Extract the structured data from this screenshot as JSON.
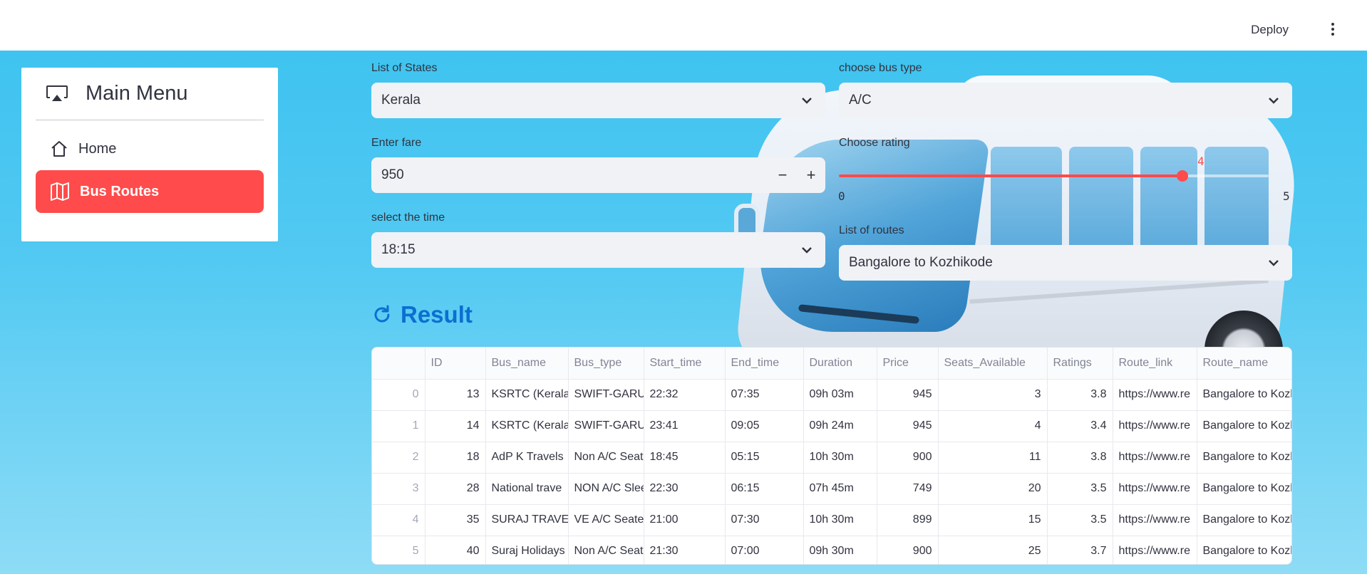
{
  "header": {
    "deploy_label": "Deploy",
    "menu_icon": "kebab-menu-icon"
  },
  "sidebar": {
    "title": "Main Menu",
    "title_icon": "airplay-icon",
    "items": [
      {
        "label": "Home",
        "icon": "home-icon",
        "active": false
      },
      {
        "label": "Bus Routes",
        "icon": "map-icon",
        "active": true
      }
    ]
  },
  "filters": {
    "states": {
      "label": "List of States",
      "value": "Kerala"
    },
    "bus_type": {
      "label": "choose bus type",
      "value": "A/C"
    },
    "fare": {
      "label": "Enter fare",
      "value": "950",
      "minus": "−",
      "plus": "+"
    },
    "rating": {
      "label": "Choose rating",
      "value": "4",
      "min": "0",
      "max": "5",
      "fraction": 0.8
    },
    "time": {
      "label": "select the time",
      "value": "18:15"
    },
    "routes": {
      "label": "List of routes",
      "value": "Bangalore to Kozhikode"
    }
  },
  "result": {
    "title": "Result",
    "icon": "refresh-icon"
  },
  "table": {
    "columns": [
      "",
      "ID",
      "Bus_name",
      "Bus_type",
      "Start_time",
      "End_time",
      "Duration",
      "Price",
      "Seats_Available",
      "Ratings",
      "Route_link",
      "Route_name"
    ],
    "rows": [
      [
        "0",
        "13",
        "KSRTC (Kerala",
        "SWIFT-GARUD",
        "22:32",
        "07:35",
        "09h 03m",
        "945",
        "3",
        "3.8",
        "https://www.re",
        "Bangalore to Kozh"
      ],
      [
        "1",
        "14",
        "KSRTC (Kerala",
        "SWIFT-GARUD",
        "23:41",
        "09:05",
        "09h 24m",
        "945",
        "4",
        "3.4",
        "https://www.re",
        "Bangalore to Kozh"
      ],
      [
        "2",
        "18",
        "AdP K Travels",
        "Non A/C Seat",
        "18:45",
        "05:15",
        "10h 30m",
        "900",
        "11",
        "3.8",
        "https://www.re",
        "Bangalore to Kozh"
      ],
      [
        "3",
        "28",
        "National trave",
        "NON A/C Slee",
        "22:30",
        "06:15",
        "07h 45m",
        "749",
        "20",
        "3.5",
        "https://www.re",
        "Bangalore to Kozh"
      ],
      [
        "4",
        "35",
        "SURAJ TRAVEL",
        "VE A/C Seater",
        "21:00",
        "07:30",
        "10h 30m",
        "899",
        "15",
        "3.5",
        "https://www.re",
        "Bangalore to Kozh"
      ],
      [
        "5",
        "40",
        "Suraj Holidays",
        "Non A/C Seat",
        "21:30",
        "07:00",
        "09h 30m",
        "900",
        "25",
        "3.7",
        "https://www.re",
        "Bangalore to Kozh"
      ]
    ]
  }
}
